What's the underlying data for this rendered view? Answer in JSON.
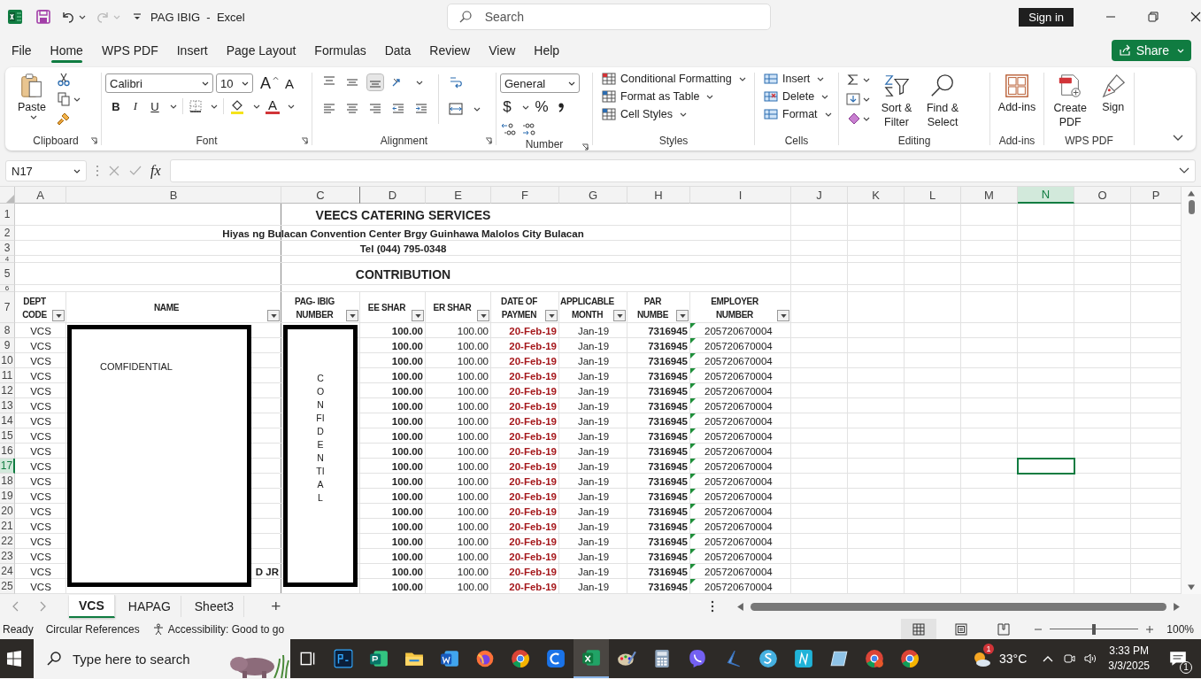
{
  "window": {
    "title": "PAG IBIG  -  Excel",
    "search_placeholder": "Search",
    "sign_in": "Sign in"
  },
  "menu_tabs": [
    {
      "label": "File",
      "selected": false
    },
    {
      "label": "Home",
      "selected": true
    },
    {
      "label": "WPS PDF",
      "selected": false
    },
    {
      "label": "Insert",
      "selected": false
    },
    {
      "label": "Page Layout",
      "selected": false
    },
    {
      "label": "Formulas",
      "selected": false
    },
    {
      "label": "Data",
      "selected": false
    },
    {
      "label": "Review",
      "selected": false
    },
    {
      "label": "View",
      "selected": false
    },
    {
      "label": "Help",
      "selected": false
    }
  ],
  "share": "Share",
  "ribbon": {
    "clipboard": {
      "label": "Clipboard",
      "paste": "Paste"
    },
    "font": {
      "label": "Font",
      "family": "Calibri",
      "size": "10",
      "grow": "A",
      "shrink": "A",
      "bold": "B",
      "italic": "I",
      "underline": "U",
      "font_color_glyph": "A"
    },
    "alignment": {
      "label": "Alignment"
    },
    "number": {
      "label": "Number",
      "format": "General",
      "currency": "$",
      "percent": "%"
    },
    "styles": {
      "label": "Styles",
      "items": [
        "Conditional Formatting",
        "Format as Table",
        "Cell Styles"
      ]
    },
    "cells": {
      "label": "Cells",
      "items": [
        "Insert",
        "Delete",
        "Format"
      ]
    },
    "editing": {
      "label": "Editing",
      "sort": "Sort & Filter",
      "find": "Find & Select"
    },
    "addins": {
      "label": "Add-ins",
      "button": "Add-ins"
    },
    "wps": {
      "label": "WPS PDF",
      "create": "Create PDF",
      "sign": "Sign"
    }
  },
  "formula_bar": {
    "name_box": "N17",
    "fx": "fx"
  },
  "sheet": {
    "columns": [
      {
        "label": "A",
        "selected": false
      },
      {
        "label": "B",
        "selected": false
      },
      {
        "label": "C",
        "selected": false
      },
      {
        "label": "D",
        "selected": false
      },
      {
        "label": "E",
        "selected": false
      },
      {
        "label": "F",
        "selected": false
      },
      {
        "label": "G",
        "selected": false
      },
      {
        "label": "H",
        "selected": false
      },
      {
        "label": "I",
        "selected": false
      },
      {
        "label": "J",
        "selected": false
      },
      {
        "label": "K",
        "selected": false
      },
      {
        "label": "L",
        "selected": false
      },
      {
        "label": "M",
        "selected": false
      },
      {
        "label": "N",
        "selected": true
      },
      {
        "label": "O",
        "selected": false
      },
      {
        "label": "P",
        "selected": false
      }
    ],
    "rows": [
      {
        "num": "1",
        "kind": "title",
        "selected": false,
        "text": "VEECS CATERING SERVICES"
      },
      {
        "num": "2",
        "kind": "subtitle",
        "selected": false,
        "text": "Hiyas ng Bulacan Convention Center Brgy Guinhawa Malolos City Bulacan"
      },
      {
        "num": "3",
        "kind": "subtitle",
        "selected": false,
        "text": "Tel (044) 795-0348"
      },
      {
        "num": "4",
        "kind": "blank",
        "selected": false
      },
      {
        "num": "5",
        "kind": "title",
        "selected": false,
        "text": "CONTRIBUTION"
      },
      {
        "num": "6",
        "kind": "blank",
        "selected": false
      },
      {
        "num": "7",
        "kind": "header",
        "selected": false,
        "headers": [
          {
            "text": "DEPT CODE",
            "filter": true
          },
          {
            "text": "NAME",
            "filter": true
          },
          {
            "text": "PAG- IBIG NUMBER",
            "filter": true
          },
          {
            "text": "EE SHAR",
            "filter": true
          },
          {
            "text": "ER SHAR",
            "filter": true
          },
          {
            "text": "DATE OF PAYMEN",
            "filter": true
          },
          {
            "text": "APPLICABLE MONTH",
            "filter": true
          },
          {
            "text": "PAR NUMBE",
            "filter": true
          },
          {
            "text": "EMPLOYER NUMBER",
            "filter": true
          }
        ]
      },
      {
        "num": "8",
        "kind": "data",
        "selected": false,
        "dept": "VCS",
        "ee": "100.00",
        "er": "100.00",
        "date": "20-Feb-19",
        "month": "Jan-19",
        "par": "7316945",
        "employer": "205720670004",
        "flag": true
      },
      {
        "num": "9",
        "kind": "data",
        "selected": false,
        "dept": "VCS",
        "ee": "100.00",
        "er": "100.00",
        "date": "20-Feb-19",
        "month": "Jan-19",
        "par": "7316945",
        "employer": "205720670004",
        "flag": true
      },
      {
        "num": "10",
        "kind": "data",
        "selected": false,
        "dept": "VCS",
        "ee": "100.00",
        "er": "100.00",
        "date": "20-Feb-19",
        "month": "Jan-19",
        "par": "7316945",
        "employer": "205720670004",
        "flag": true
      },
      {
        "num": "11",
        "kind": "data",
        "selected": false,
        "dept": "VCS",
        "ee": "100.00",
        "er": "100.00",
        "date": "20-Feb-19",
        "month": "Jan-19",
        "par": "7316945",
        "employer": "205720670004",
        "flag": true
      },
      {
        "num": "12",
        "kind": "data",
        "selected": false,
        "dept": "VCS",
        "ee": "100.00",
        "er": "100.00",
        "date": "20-Feb-19",
        "month": "Jan-19",
        "par": "7316945",
        "employer": "205720670004",
        "flag": true
      },
      {
        "num": "13",
        "kind": "data",
        "selected": false,
        "dept": "VCS",
        "ee": "100.00",
        "er": "100.00",
        "date": "20-Feb-19",
        "month": "Jan-19",
        "par": "7316945",
        "employer": "205720670004",
        "flag": true
      },
      {
        "num": "14",
        "kind": "data",
        "selected": false,
        "dept": "VCS",
        "ee": "100.00",
        "er": "100.00",
        "date": "20-Feb-19",
        "month": "Jan-19",
        "par": "7316945",
        "employer": "205720670004",
        "flag": true
      },
      {
        "num": "15",
        "kind": "data",
        "selected": false,
        "dept": "VCS",
        "ee": "100.00",
        "er": "100.00",
        "date": "20-Feb-19",
        "month": "Jan-19",
        "par": "7316945",
        "employer": "205720670004",
        "flag": true
      },
      {
        "num": "16",
        "kind": "data",
        "selected": false,
        "dept": "VCS",
        "ee": "100.00",
        "er": "100.00",
        "date": "20-Feb-19",
        "month": "Jan-19",
        "par": "7316945",
        "employer": "205720670004",
        "flag": true
      },
      {
        "num": "17",
        "kind": "data",
        "selected": true,
        "dept": "VCS",
        "ee": "100.00",
        "er": "100.00",
        "date": "20-Feb-19",
        "month": "Jan-19",
        "par": "7316945",
        "employer": "205720670004",
        "flag": true
      },
      {
        "num": "18",
        "kind": "data",
        "selected": false,
        "dept": "VCS",
        "ee": "100.00",
        "er": "100.00",
        "date": "20-Feb-19",
        "month": "Jan-19",
        "par": "7316945",
        "employer": "205720670004",
        "flag": true
      },
      {
        "num": "19",
        "kind": "data",
        "selected": false,
        "dept": "VCS",
        "ee": "100.00",
        "er": "100.00",
        "date": "20-Feb-19",
        "month": "Jan-19",
        "par": "7316945",
        "employer": "205720670004",
        "flag": true
      },
      {
        "num": "20",
        "kind": "data",
        "selected": false,
        "dept": "VCS",
        "ee": "100.00",
        "er": "100.00",
        "date": "20-Feb-19",
        "month": "Jan-19",
        "par": "7316945",
        "employer": "205720670004",
        "flag": true
      },
      {
        "num": "21",
        "kind": "data",
        "selected": false,
        "dept": "VCS",
        "ee": "100.00",
        "er": "100.00",
        "date": "20-Feb-19",
        "month": "Jan-19",
        "par": "7316945",
        "employer": "205720670004",
        "flag": true
      },
      {
        "num": "22",
        "kind": "data",
        "selected": false,
        "dept": "VCS",
        "ee": "100.00",
        "er": "100.00",
        "date": "20-Feb-19",
        "month": "Jan-19",
        "par": "7316945",
        "employer": "205720670004",
        "flag": true
      },
      {
        "num": "23",
        "kind": "data",
        "selected": false,
        "dept": "VCS",
        "ee": "100.00",
        "er": "100.00",
        "date": "20-Feb-19",
        "month": "Jan-19",
        "par": "7316945",
        "employer": "205720670004",
        "flag": true
      },
      {
        "num": "24",
        "kind": "data",
        "selected": false,
        "dept": "VCS",
        "name": "D JR",
        "ee": "100.00",
        "er": "100.00",
        "date": "20-Feb-19",
        "month": "Jan-19",
        "par": "7316945",
        "employer": "205720670004",
        "flag": true
      },
      {
        "num": "25",
        "kind": "data",
        "selected": false,
        "dept": "VCS",
        "ee": "100.00",
        "er": "100.00",
        "date": "20-Feb-19",
        "month": "Jan-19",
        "par": "7316945",
        "employer": "205720670004",
        "flag": true
      }
    ],
    "redactions": [
      {
        "kind": "horizontal",
        "lines": [
          "COMFIDENTIAL"
        ]
      },
      {
        "kind": "vertical",
        "lines": [
          "C",
          "O",
          "N",
          "FI",
          "D",
          "E",
          "N",
          "TI",
          "A",
          "L"
        ]
      }
    ]
  },
  "sheet_tabs": [
    {
      "label": "VCS",
      "selected": true
    },
    {
      "label": "HAPAG",
      "selected": false
    },
    {
      "label": "Sheet3",
      "selected": false
    }
  ],
  "add_sheet": "+",
  "status_bar": {
    "ready": "Ready",
    "circular": "Circular References",
    "accessibility": "Accessibility: Good to go",
    "views": [
      {
        "selected": true
      },
      {
        "selected": false
      },
      {
        "selected": false
      }
    ],
    "zoom": {
      "level": 0.5,
      "reading": "100%"
    }
  },
  "taskbar": {
    "search_placeholder": "Type here to search",
    "weather_badge": "1",
    "temperature": "33°C",
    "time": "3:33 PM",
    "date": "3/3/2025",
    "notification_count": "1"
  }
}
